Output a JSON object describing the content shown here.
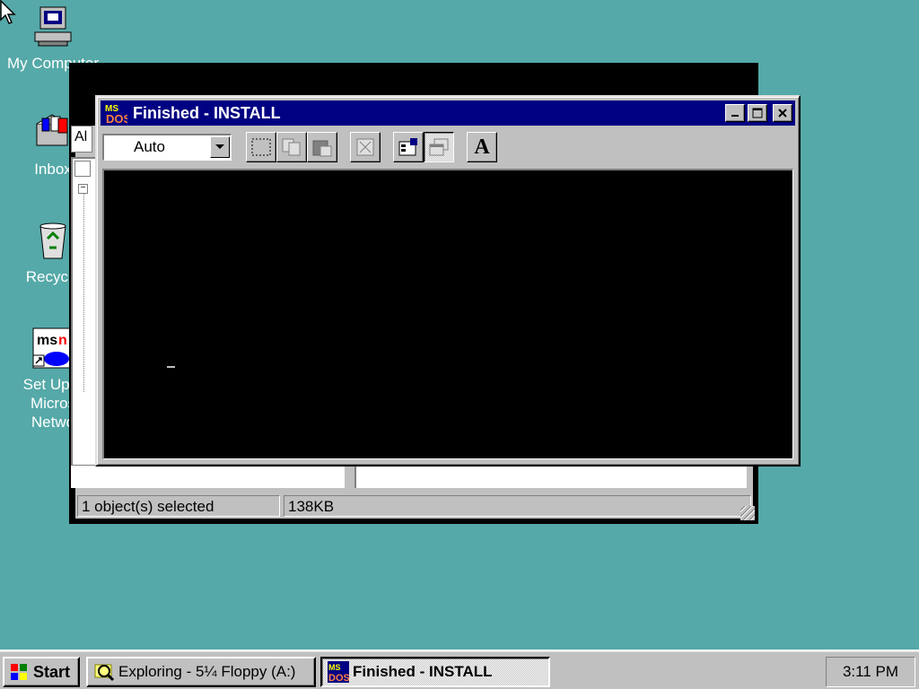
{
  "desktop": {
    "background_color": "#55a9a8",
    "icons": [
      {
        "label": "My Computer",
        "icon": "computer-icon"
      },
      {
        "label": "Inbox",
        "icon": "inbox-icon"
      },
      {
        "label": "Recycle",
        "icon": "recycle-bin-icon"
      },
      {
        "label": "Set Up T\nMicros\nNetwo",
        "icon": "msn-icon"
      }
    ]
  },
  "explorer": {
    "address_text": "Al",
    "status": {
      "selection": "1 object(s) selected",
      "size": "138KB"
    }
  },
  "dos_window": {
    "title": "Finished - INSTALL",
    "title_bar_color": "#000082",
    "font_size_value": "Auto",
    "toolbar_icons": [
      "mark-icon",
      "copy-icon",
      "paste-icon",
      "fullscreen-icon",
      "properties-icon",
      "background-icon",
      "font-icon"
    ],
    "font_button_glyph": "A"
  },
  "taskbar": {
    "start_label": "Start",
    "tasks": [
      {
        "label": "Exploring - 5¼ Floppy (A:)",
        "icon": "explorer-icon",
        "active": false
      },
      {
        "label": "Finished - INSTALL",
        "icon": "msdos-icon",
        "active": true
      }
    ],
    "clock": "3:11 PM"
  }
}
